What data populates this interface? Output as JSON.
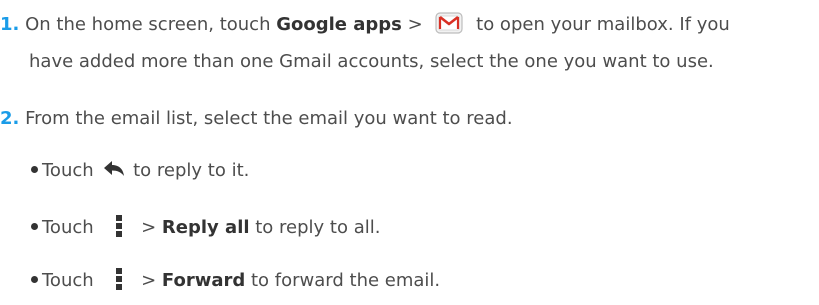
{
  "steps": [
    {
      "number": "1.",
      "line1_pre": "On the home screen, touch ",
      "line1_bold": "Google apps",
      "line1_sep": " > ",
      "line1_post": " to open your mailbox. If you",
      "line2": "have added more than one Gmail accounts, select the one you want to use."
    },
    {
      "number": "2.",
      "text": "From the email list, select the email you want to read."
    }
  ],
  "bullets": [
    {
      "pre": "Touch ",
      "icon": "reply-arrow-icon",
      "post": " to reply to it."
    },
    {
      "pre": "Touch ",
      "icon": "menu-dots-icon",
      "sep": " > ",
      "bold": "Reply all",
      "post": " to reply to all."
    },
    {
      "pre": "Touch ",
      "icon": "menu-dots-icon",
      "sep": " > ",
      "bold": "Forward",
      "post": " to forward the email."
    }
  ],
  "colors": {
    "step_number": "#1a9ce8",
    "text": "#4d4d4d",
    "bold": "#333333",
    "gmail_red": "#d93025"
  }
}
